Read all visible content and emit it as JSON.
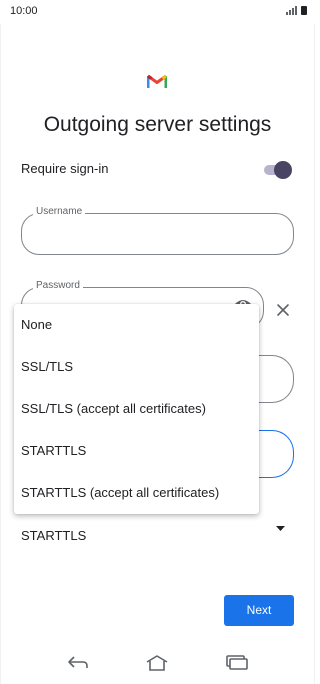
{
  "status_bar": {
    "time": "10:00",
    "icons": [
      "signal-icon",
      "battery-icon"
    ]
  },
  "header": {
    "logo": "gmail-icon",
    "title": "Outgoing server settings"
  },
  "require_signin": {
    "label": "Require sign-in",
    "enabled": true
  },
  "username": {
    "label": "Username",
    "value": ""
  },
  "password": {
    "label": "Password",
    "value": "",
    "icons": [
      "eye-icon",
      "close-icon"
    ]
  },
  "security_type": {
    "selected": "STARTTLS",
    "options": [
      "None",
      "SSL/TLS",
      "SSL/TLS (accept all certificates)",
      "STARTTLS",
      "STARTTLS (accept all certificates)"
    ]
  },
  "actions": {
    "next_label": "Next"
  },
  "navigation": {
    "icons": [
      "back-icon",
      "home-icon",
      "recent-apps-icon"
    ]
  },
  "colors": {
    "accent": "#1a73e8",
    "toggle_thumb": "#4a4463",
    "toggle_track": "#b8b2cf",
    "text": "#202124"
  }
}
